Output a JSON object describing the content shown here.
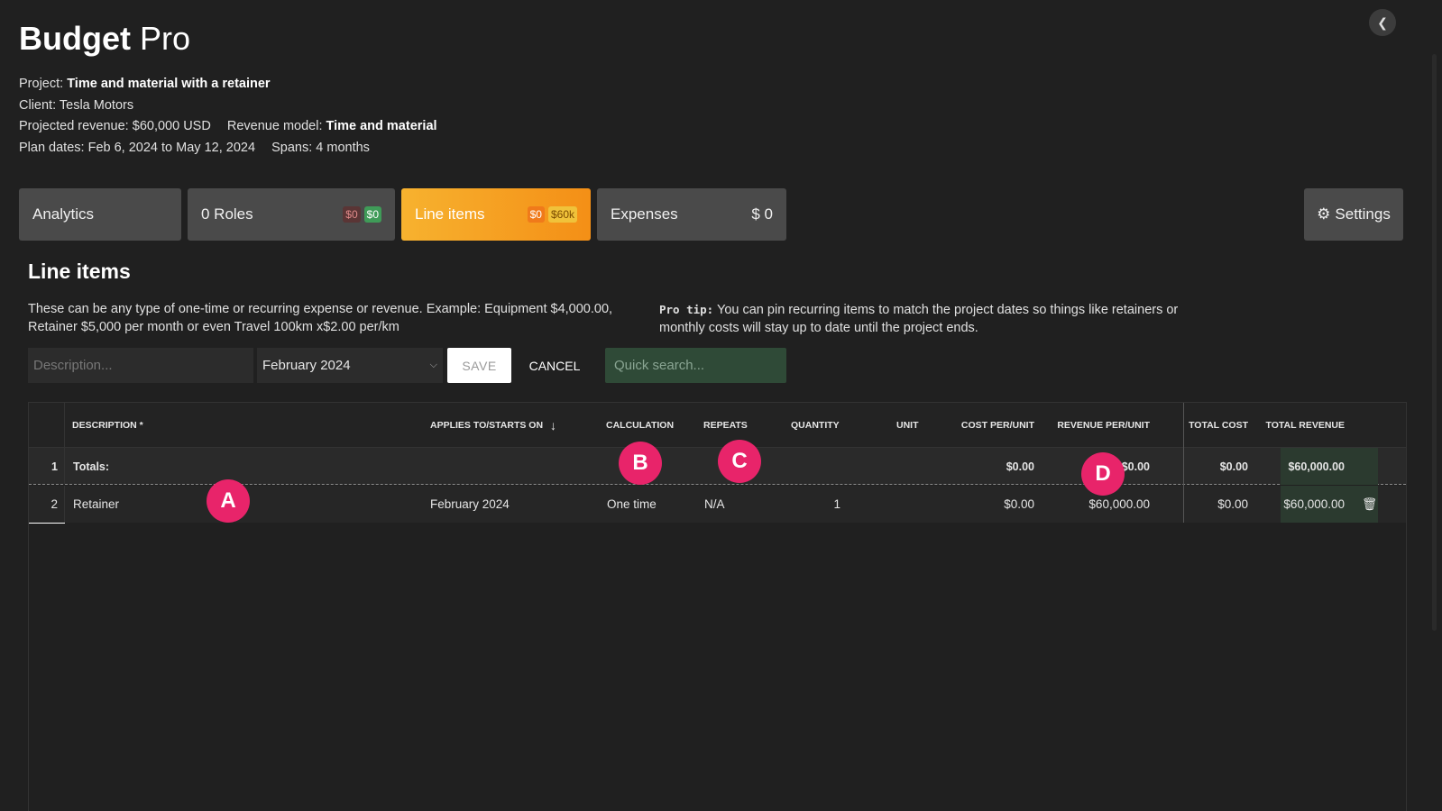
{
  "app": {
    "title_bold": "Budget",
    "title_light": "Pro",
    "collapse_icon": "chevron-left-icon"
  },
  "meta": {
    "project_label": "Project:",
    "project_value": "Time and material with a retainer",
    "client_label": "Client:",
    "client_value": "Tesla Motors",
    "revenue_label": "Projected revenue:",
    "revenue_value": "$60,000 USD",
    "model_label": "Revenue model:",
    "model_value": "Time and material",
    "dates_label": "Plan dates:",
    "start_date": "Feb 6, 2024",
    "to": "to",
    "end_date": "May 12, 2024",
    "spans_label": "Spans:",
    "spans_value": "4 months"
  },
  "tabs": {
    "analytics": "Analytics",
    "roles": "0 Roles",
    "roles_cost": "$0",
    "roles_revenue": "$0",
    "line_items": "Line items",
    "line_cost": "$0",
    "line_revenue": "$60k",
    "expenses": "Expenses",
    "expenses_value": "$ 0",
    "settings": "Settings",
    "active_color": "#f5a623"
  },
  "section": {
    "title": "Line items",
    "description": "These can be any type of one-time or recurring expense or revenue. Example: Equipment $4,000.00, Retainer $5,000 per month or even Travel 100km x$2.00 per/km",
    "tip_label": "Pro tip:",
    "tip_text": "You can pin recurring items to match the project dates so things like retainers or monthly costs will stay up to date until the project ends."
  },
  "form": {
    "description_placeholder": "Description...",
    "month_value": "February 2024",
    "save_label": "SAVE",
    "cancel_label": "CANCEL",
    "search_placeholder": "Quick search..."
  },
  "table": {
    "headers": {
      "description": "DESCRIPTION *",
      "applies": "APPLIES TO/STARTS ON",
      "calculation": "CALCULATION",
      "repeats": "REPEATS",
      "quantity": "QUANTITY",
      "unit": "UNIT",
      "cost_per_unit": "COST PER/UNIT",
      "revenue_per_unit": "REVENUE PER/UNIT",
      "total_cost": "TOTAL COST",
      "total_revenue": "TOTAL REVENUE"
    },
    "sort_icon": "arrow-down-icon",
    "totals": {
      "num": "1",
      "label": "Totals:",
      "cost_per_unit": "$0.00",
      "revenue_per_unit": "$0.00",
      "total_cost": "$0.00",
      "total_revenue": "$60,000.00"
    },
    "rows": [
      {
        "num": "2",
        "description": "Retainer",
        "applies": "February 2024",
        "calculation": "One time",
        "repeats": "N/A",
        "quantity": "1",
        "unit": "",
        "cost_per_unit": "$0.00",
        "revenue_per_unit": "$60,000.00",
        "total_cost": "$0.00",
        "total_revenue": "$60,000.00",
        "delete_icon": "trash-icon"
      }
    ]
  },
  "markers": {
    "a": "A",
    "b": "B",
    "c": "C",
    "d": "D",
    "color": "#e8246a"
  }
}
